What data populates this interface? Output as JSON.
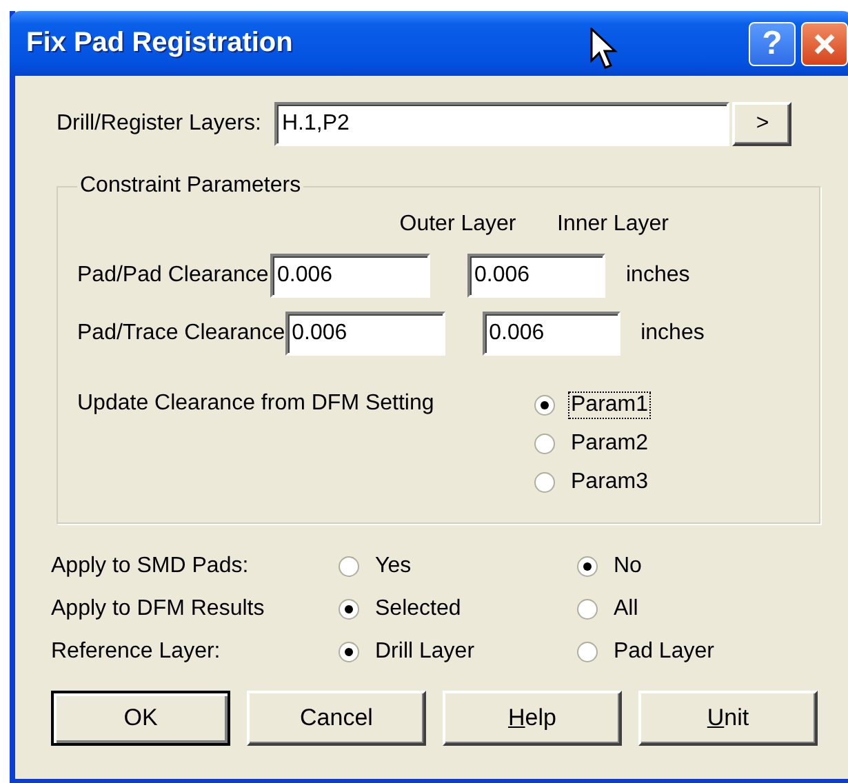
{
  "window": {
    "title": "Fix Pad Registration",
    "help_button": "?"
  },
  "layers": {
    "label": "Drill/Register Layers:",
    "value": "H.1,P2",
    "browse_button": ">"
  },
  "constraints": {
    "title": "Constraint Parameters",
    "columns": [
      "Outer Layer",
      "Inner Layer"
    ],
    "rows": [
      {
        "label": "Pad/Pad Clearance",
        "outer": "0.006",
        "inner": "0.006",
        "unit": "inches"
      },
      {
        "label": "Pad/Trace Clearance",
        "outer": "0.006",
        "inner": "0.006",
        "unit": "inches"
      }
    ],
    "update_label": "Update Clearance from DFM Setting",
    "params": [
      {
        "label": "Param1",
        "selected": true,
        "focused": true
      },
      {
        "label": "Param2",
        "selected": false,
        "focused": false
      },
      {
        "label": "Param3",
        "selected": false,
        "focused": false
      }
    ]
  },
  "options": [
    {
      "label": "Apply to SMD Pads:",
      "choices": [
        {
          "label": "Yes",
          "selected": false
        },
        {
          "label": "No",
          "selected": true
        }
      ]
    },
    {
      "label": "Apply to DFM Results",
      "choices": [
        {
          "label": "Selected",
          "selected": true
        },
        {
          "label": "All",
          "selected": false
        }
      ]
    },
    {
      "label": "Reference Layer:",
      "choices": [
        {
          "label": "Drill Layer",
          "selected": true
        },
        {
          "label": "Pad Layer",
          "selected": false
        }
      ]
    }
  ],
  "buttons": [
    {
      "label": "OK",
      "default": true,
      "underline_first": false
    },
    {
      "label": "Cancel",
      "default": false,
      "underline_first": false
    },
    {
      "label": "Help",
      "default": false,
      "underline_first": true
    },
    {
      "label": "Unit",
      "default": false,
      "underline_first": true
    }
  ]
}
